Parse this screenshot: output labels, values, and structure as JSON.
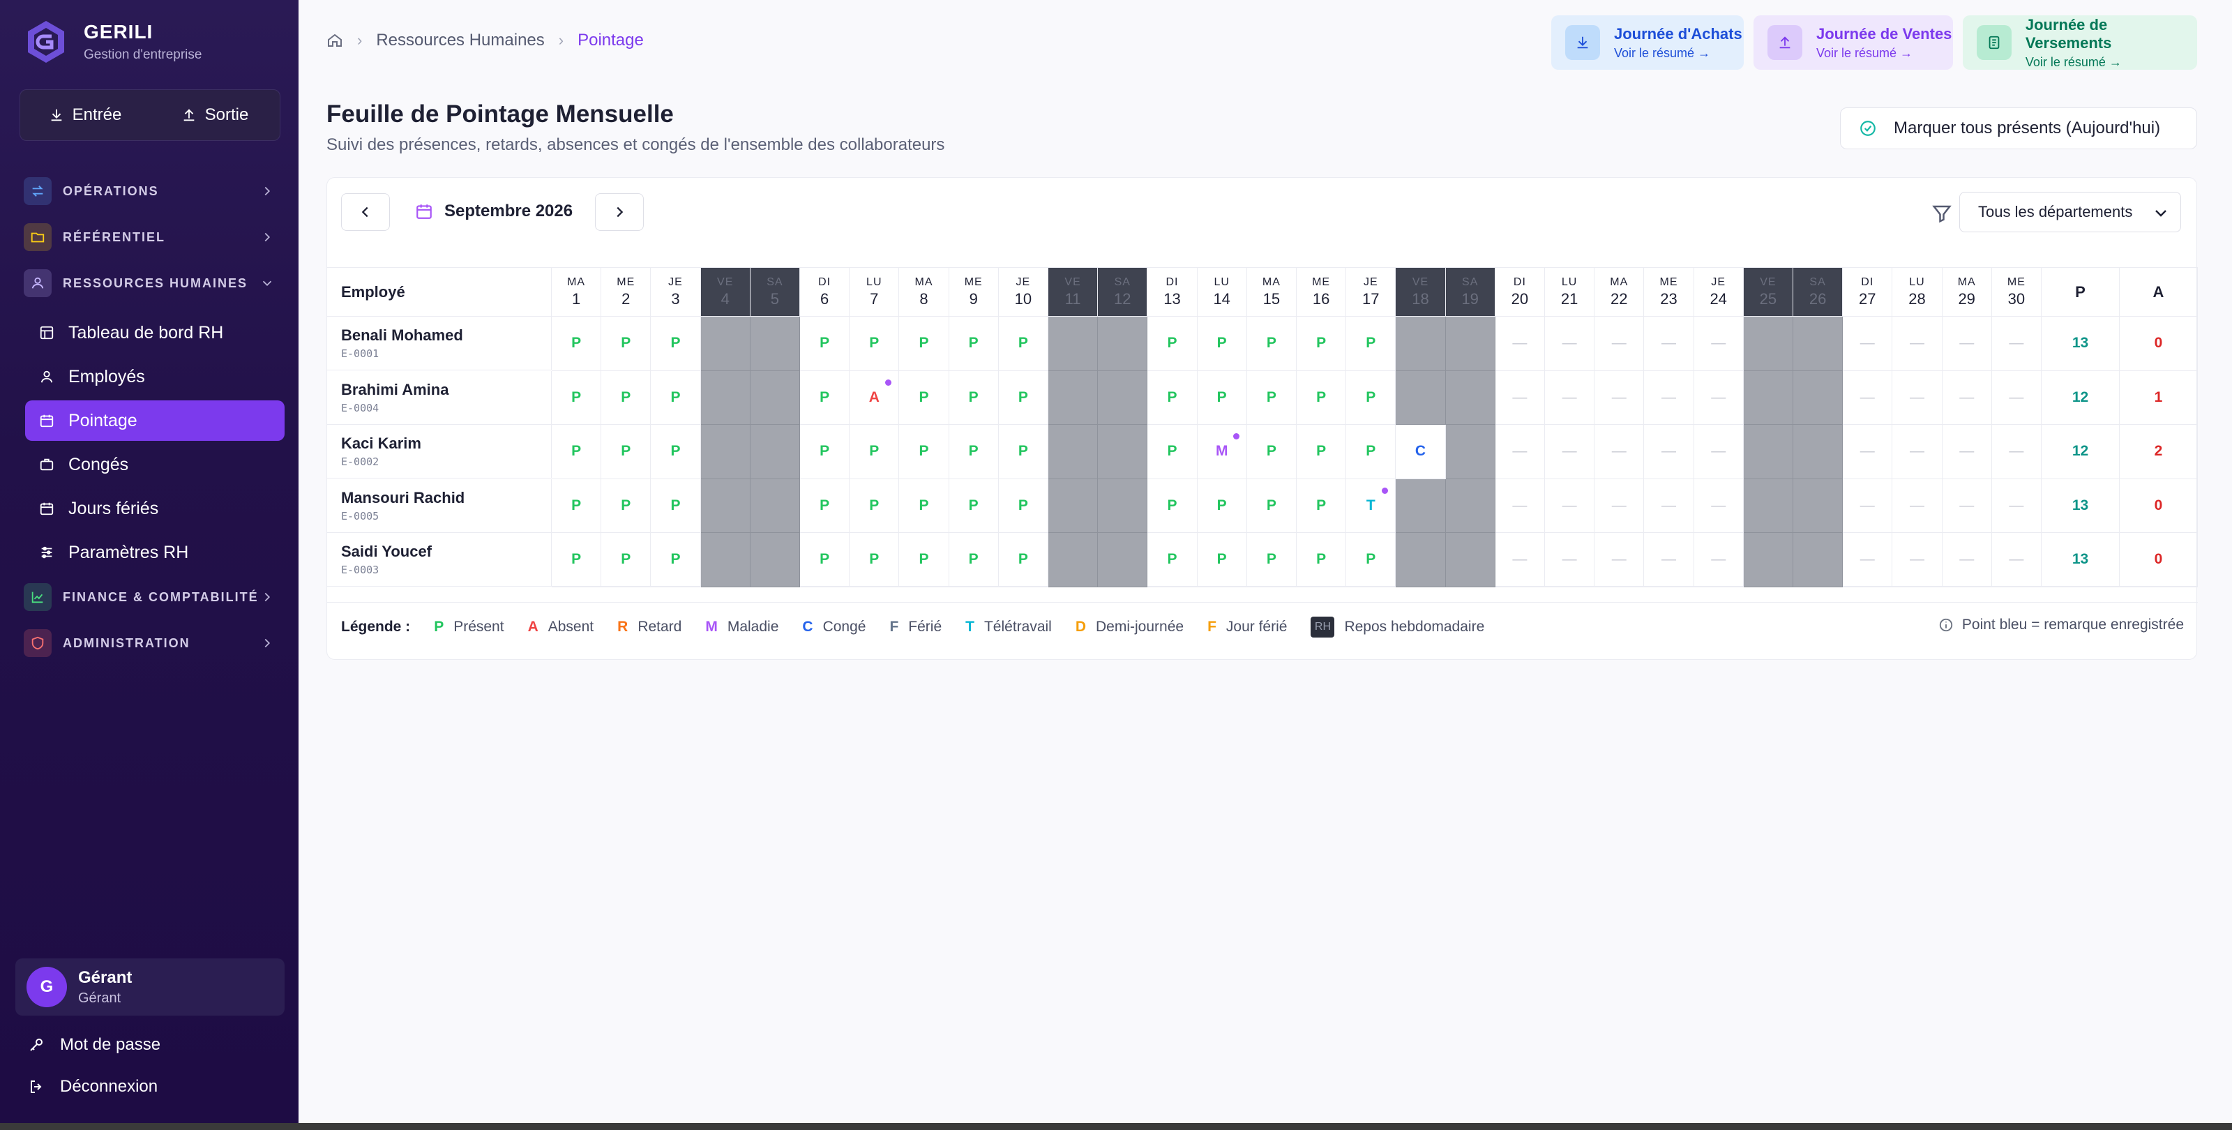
{
  "brand": {
    "title": "GERILI",
    "subtitle": "Gestion d'entreprise"
  },
  "io": {
    "in_label": "Entrée",
    "out_label": "Sortie"
  },
  "nav": {
    "sections": [
      {
        "label": "OPÉRATIONS",
        "icon": "arrows-icon",
        "color": "#60a5fa"
      },
      {
        "label": "RÉFÉRENTIEL",
        "icon": "folder-icon",
        "color": "#facc15"
      },
      {
        "label": "RESSOURCES HUMAINES",
        "icon": "user-icon",
        "color": "#c4b5fd"
      },
      {
        "label": "FINANCE & COMPTABILITÉ",
        "icon": "chart-icon",
        "color": "#4ade80"
      },
      {
        "label": "ADMINISTRATION",
        "icon": "shield-icon",
        "color": "#f87171"
      }
    ],
    "items": [
      {
        "label": "Tableau de bord RH",
        "icon": "dashboard-icon"
      },
      {
        "label": "Employés",
        "icon": "person-icon"
      },
      {
        "label": "Pointage",
        "icon": "calendar-icon",
        "active": true
      },
      {
        "label": "Congés",
        "icon": "briefcase-icon"
      },
      {
        "label": "Jours fériés",
        "icon": "calendar-icon"
      },
      {
        "label": "Paramètres RH",
        "icon": "sliders-icon"
      }
    ]
  },
  "user": {
    "initial": "G",
    "name": "Gérant",
    "role": "Gérant"
  },
  "bottom": {
    "password": "Mot de passe",
    "logout": "Déconnexion"
  },
  "breadcrumb": {
    "parent": "Ressources Humaines",
    "current": "Pointage"
  },
  "journals": [
    {
      "title": "Journée d'Achats",
      "sub": "Voir le résumé →",
      "bg": "#e3effd",
      "ic_bg": "#bfdcfb",
      "color": "#1d4ed8"
    },
    {
      "title": "Journée de Ventes",
      "sub": "Voir le résumé →",
      "bg": "#efe7fd",
      "ic_bg": "#dccafb",
      "color": "#7c3aed"
    },
    {
      "title": "Journée de Versements",
      "sub": "Voir le résumé →",
      "bg": "#e2f6ec",
      "ic_bg": "#b7ebd2",
      "color": "#047857"
    }
  ],
  "page": {
    "title": "Feuille de Pointage Mensuelle",
    "subtitle": "Suivi des présences, retards, absences et congés de l'ensemble des collaborateurs",
    "mark_all": "Marquer tous présents (Aujourd'hui)"
  },
  "toolbar": {
    "month": "Septembre 2026",
    "department": "Tous les départements"
  },
  "table": {
    "employee_header": "Employé",
    "total_p": "P",
    "total_a": "A",
    "days": [
      {
        "n": "MA",
        "d": "1"
      },
      {
        "n": "ME",
        "d": "2"
      },
      {
        "n": "JE",
        "d": "3"
      },
      {
        "n": "VE",
        "d": "4",
        "we": true
      },
      {
        "n": "SA",
        "d": "5",
        "we": true
      },
      {
        "n": "DI",
        "d": "6"
      },
      {
        "n": "LU",
        "d": "7"
      },
      {
        "n": "MA",
        "d": "8"
      },
      {
        "n": "ME",
        "d": "9"
      },
      {
        "n": "JE",
        "d": "10"
      },
      {
        "n": "VE",
        "d": "11",
        "we": true
      },
      {
        "n": "SA",
        "d": "12",
        "we": true
      },
      {
        "n": "DI",
        "d": "13"
      },
      {
        "n": "LU",
        "d": "14"
      },
      {
        "n": "MA",
        "d": "15"
      },
      {
        "n": "ME",
        "d": "16"
      },
      {
        "n": "JE",
        "d": "17"
      },
      {
        "n": "VE",
        "d": "18",
        "we": true
      },
      {
        "n": "SA",
        "d": "19",
        "we": true
      },
      {
        "n": "DI",
        "d": "20"
      },
      {
        "n": "LU",
        "d": "21"
      },
      {
        "n": "MA",
        "d": "22"
      },
      {
        "n": "ME",
        "d": "23"
      },
      {
        "n": "JE",
        "d": "24"
      },
      {
        "n": "VE",
        "d": "25",
        "we": true
      },
      {
        "n": "SA",
        "d": "26",
        "we": true
      },
      {
        "n": "DI",
        "d": "27"
      },
      {
        "n": "LU",
        "d": "28"
      },
      {
        "n": "MA",
        "d": "29"
      },
      {
        "n": "ME",
        "d": "30"
      }
    ],
    "rows": [
      {
        "name": "Benali Mohamed",
        "code": "E-0001",
        "p": "13",
        "a": "0",
        "cells": [
          "P",
          "P",
          "P",
          "",
          "",
          "P",
          "P",
          "P",
          "P",
          "P",
          "",
          "",
          "P",
          "P",
          "P",
          "P",
          "P",
          "",
          "",
          "—",
          "—",
          "—",
          "—",
          "—",
          "",
          "",
          "—",
          "—",
          "—",
          "—"
        ],
        "dots": []
      },
      {
        "name": "Brahimi Amina",
        "code": "E-0004",
        "p": "12",
        "a": "1",
        "cells": [
          "P",
          "P",
          "P",
          "",
          "",
          "P",
          "A",
          "P",
          "P",
          "P",
          "",
          "",
          "P",
          "P",
          "P",
          "P",
          "P",
          "",
          "",
          "—",
          "—",
          "—",
          "—",
          "—",
          "",
          "",
          "—",
          "—",
          "—",
          "—"
        ],
        "dots": [
          6
        ]
      },
      {
        "name": "Kaci Karim",
        "code": "E-0002",
        "p": "12",
        "a": "2",
        "cells": [
          "P",
          "P",
          "P",
          "",
          "",
          "P",
          "P",
          "P",
          "P",
          "P",
          "",
          "",
          "P",
          "M",
          "P",
          "P",
          "P",
          "C",
          "",
          "—",
          "—",
          "—",
          "—",
          "—",
          "",
          "",
          "—",
          "—",
          "—",
          "—"
        ],
        "dots": [
          13
        ]
      },
      {
        "name": "Mansouri Rachid",
        "code": "E-0005",
        "p": "13",
        "a": "0",
        "cells": [
          "P",
          "P",
          "P",
          "",
          "",
          "P",
          "P",
          "P",
          "P",
          "P",
          "",
          "",
          "P",
          "P",
          "P",
          "P",
          "T",
          "",
          "",
          "—",
          "—",
          "—",
          "—",
          "—",
          "",
          "",
          "—",
          "—",
          "—",
          "—"
        ],
        "dots": [
          16
        ]
      },
      {
        "name": "Saidi Youcef",
        "code": "E-0003",
        "p": "13",
        "a": "0",
        "cells": [
          "P",
          "P",
          "P",
          "",
          "",
          "P",
          "P",
          "P",
          "P",
          "P",
          "",
          "",
          "P",
          "P",
          "P",
          "P",
          "P",
          "",
          "",
          "—",
          "—",
          "—",
          "—",
          "—",
          "",
          "",
          "—",
          "—",
          "—",
          "—"
        ],
        "dots": []
      }
    ]
  },
  "status_colors": {
    "P": "#22c55e",
    "A": "#ef4444",
    "R": "#f97316",
    "M": "#a855f7",
    "C": "#2563eb",
    "F": "#64748b",
    "T": "#06b6d4",
    "D": "#f59e0b",
    "JF": "#f59e0b",
    "total_p": "#0d9488",
    "total_a": "#dc2626"
  },
  "legend": {
    "title": "Légende :",
    "items": [
      {
        "key": "P",
        "label": "Présent",
        "color": "#22c55e"
      },
      {
        "key": "A",
        "label": "Absent",
        "color": "#ef4444"
      },
      {
        "key": "R",
        "label": "Retard",
        "color": "#f97316"
      },
      {
        "key": "M",
        "label": "Maladie",
        "color": "#a855f7"
      },
      {
        "key": "C",
        "label": "Congé",
        "color": "#2563eb"
      },
      {
        "key": "F",
        "label": "Férié",
        "color": "#64748b"
      },
      {
        "key": "T",
        "label": "Télétravail",
        "color": "#06b6d4"
      },
      {
        "key": "D",
        "label": "Demi-journée",
        "color": "#f59e0b"
      },
      {
        "key": "F",
        "label": "Jour férié",
        "color": "#f59e0b"
      }
    ],
    "rh_key": "RH",
    "rh_label": "Repos hebdomadaire",
    "note": "Point bleu = remarque enregistrée"
  }
}
